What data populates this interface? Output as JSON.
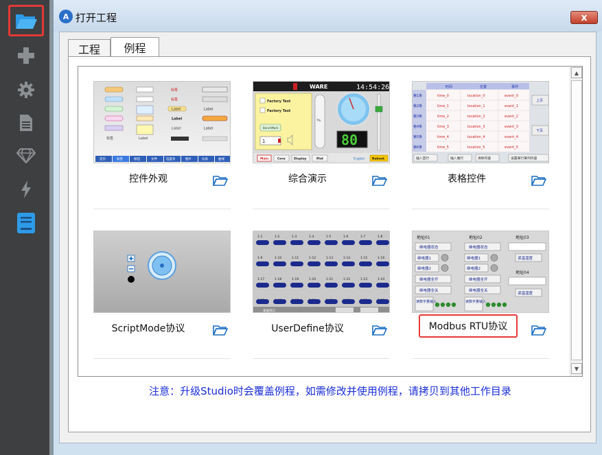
{
  "window": {
    "title": "打开工程",
    "close_label": "x"
  },
  "sidebar": {
    "items": [
      {
        "icon": "folder-open-icon",
        "active": true
      },
      {
        "icon": "plus-icon"
      },
      {
        "icon": "gear-icon"
      },
      {
        "icon": "document-icon"
      },
      {
        "icon": "diamond-icon"
      },
      {
        "icon": "lightning-icon"
      },
      {
        "icon": "book-icon"
      }
    ]
  },
  "tabs": [
    {
      "label": "工程",
      "active": false
    },
    {
      "label": "例程",
      "active": true
    }
  ],
  "examples": [
    {
      "label": "控件外观"
    },
    {
      "label": "综合演示"
    },
    {
      "label": "表格控件"
    },
    {
      "label": "ScriptMode协议"
    },
    {
      "label": "UserDefine协议"
    },
    {
      "label": "Modbus RTU协议",
      "highlighted": true
    }
  ],
  "thumbs": {
    "demo": {
      "brand": "WARE",
      "time": "14:54:26",
      "check1": "Factory Test",
      "check2": "Factory Test",
      "bench": "BenchMark",
      "spin_value": "1",
      "percent": "7%",
      "big_value": "80",
      "tabs": [
        "Main",
        "Core",
        "Display",
        "Plot"
      ],
      "lang": "English",
      "reboot": "Reboot"
    },
    "table": {
      "headers": [
        "时间",
        "位置",
        "事件"
      ],
      "rows": [
        [
          "第1条",
          "time_0",
          "location_0",
          "event_0"
        ],
        [
          "第2条",
          "time_1",
          "location_1",
          "event_1"
        ],
        [
          "第3条",
          "time_2",
          "location_2",
          "event_2"
        ],
        [
          "第4条",
          "time_3",
          "location_3",
          "event_3"
        ],
        [
          "第5条",
          "time_4",
          "location_4",
          "event_4"
        ],
        [
          "第6条",
          "time_5",
          "location_5",
          "event_5"
        ]
      ],
      "up": "上页",
      "down": "下页",
      "bottom": [
        "插入首行",
        "插入尾行",
        "清除内容",
        "设置某行某列内容"
      ]
    },
    "modbus": {
      "addr1": "地址01",
      "addr2": "地址02",
      "addr3": "地址03",
      "addr4": "地址04",
      "relay_state": "继电器状态",
      "relay1": "继电器1",
      "relay2": "继电器2",
      "all_on": "继电器全开",
      "all_off": "继电器全关",
      "read_temp": "读温湿度",
      "read_digital": "读数字量输入"
    },
    "appearance": {
      "nav": [
        "首页",
        "标签",
        "按钮",
        "文件",
        "选度条",
        "图片",
        "仪表",
        "曲线"
      ],
      "label": "Label",
      "tag": "标签"
    },
    "userdefine": {
      "status": "发送串口"
    }
  },
  "note": {
    "prefix": "注意：升级",
    "studio": "Studio",
    "suffix": "时会覆盖例程，如需修改并使用例程，请拷贝到其他工作目录"
  }
}
